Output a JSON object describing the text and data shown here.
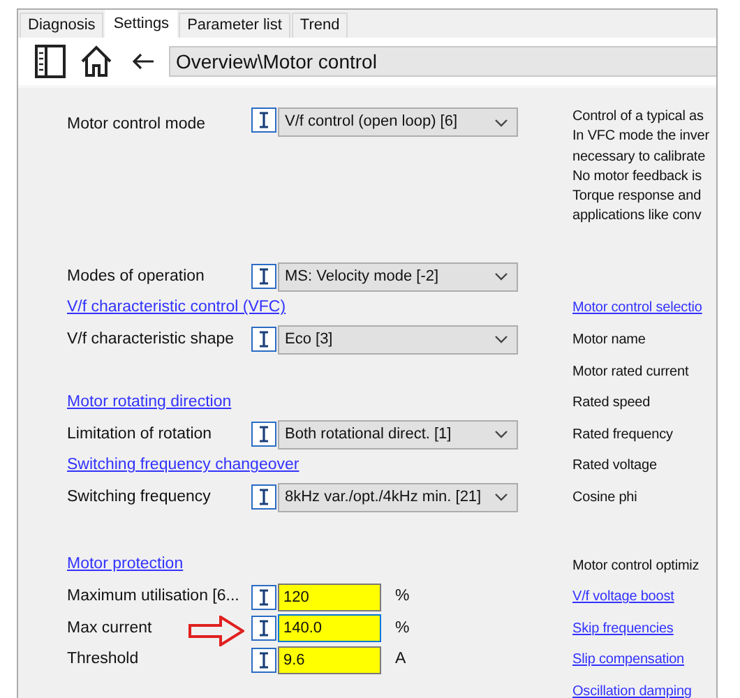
{
  "tabs": [
    {
      "label": "Diagnosis",
      "selected": false
    },
    {
      "label": "Settings",
      "selected": true
    },
    {
      "label": "Parameter list",
      "selected": false
    },
    {
      "label": "Trend",
      "selected": false
    }
  ],
  "toolbar": {
    "path": "Overview\\Motor control"
  },
  "mode": {
    "label": "Motor control mode",
    "value": "V/f control (open loop) [6]"
  },
  "description": [
    "Control of a typical as",
    "In VFC mode the inver",
    "necessary to calibrate",
    "No motor feedback is",
    "Torque response and",
    "applications like conv"
  ],
  "sections": [
    {
      "rows": [
        {
          "left": {
            "kind": "select",
            "label": "Modes of operation",
            "value": "MS: Velocity mode [-2]"
          }
        },
        {
          "left": {
            "kind": "link",
            "label": "V/f characteristic control (VFC)"
          },
          "right": {
            "kind": "link",
            "text": "Motor control selectio"
          }
        },
        {
          "left": {
            "kind": "select",
            "label": "V/f characteristic shape",
            "value": "Eco [3]"
          },
          "right": {
            "kind": "text",
            "text": "Motor name"
          }
        },
        {
          "right": {
            "kind": "text",
            "text": "Motor rated current"
          }
        },
        {
          "left": {
            "kind": "link",
            "label": "Motor rotating direction"
          },
          "right": {
            "kind": "text",
            "text": "Rated speed"
          }
        },
        {
          "left": {
            "kind": "select",
            "label": "Limitation of rotation",
            "value": "Both rotational direct. [1]"
          },
          "right": {
            "kind": "text",
            "text": "Rated frequency"
          }
        },
        {
          "left": {
            "kind": "link",
            "label": "Switching frequency changeover"
          },
          "right": {
            "kind": "text",
            "text": "Rated voltage"
          }
        },
        {
          "left": {
            "kind": "select",
            "label": "Switching frequency",
            "value": "8kHz var./opt./4kHz min. [21]"
          },
          "right": {
            "kind": "text",
            "text": "Cosine phi"
          }
        }
      ]
    },
    {
      "rows": [
        {
          "left": {
            "kind": "link",
            "label": "Motor protection"
          },
          "right": {
            "kind": "text",
            "text": "Motor control optimiz"
          }
        },
        {
          "left": {
            "kind": "input",
            "label": "Maximum utilisation [6...",
            "value": "120",
            "unit": "%",
            "focused": false
          },
          "right": {
            "kind": "link",
            "text": "V/f voltage boost"
          }
        },
        {
          "left": {
            "kind": "input",
            "label": "Max current",
            "value": "140.0",
            "unit": "%",
            "focused": true,
            "pointer_arrow": true
          },
          "right": {
            "kind": "link",
            "text": "Skip frequencies"
          }
        },
        {
          "left": {
            "kind": "input",
            "label": "Threshold",
            "value": "9.6",
            "unit": "A",
            "focused": false
          },
          "right": {
            "kind": "link",
            "text": "Slip compensation"
          }
        },
        {
          "right": {
            "kind": "link",
            "text": "Oscillation damping"
          }
        }
      ]
    }
  ]
}
